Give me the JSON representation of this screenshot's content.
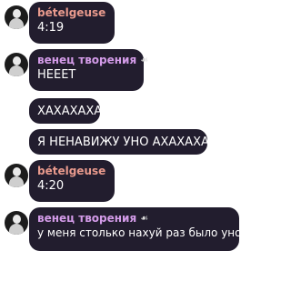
{
  "messages": [
    {
      "author": "bételgeuse",
      "badge_icon": "image-badge-icon",
      "text": "4:19"
    },
    {
      "author": "венец творения",
      "badge_icon": "emoji-badge-icon",
      "badge_glyph": "☙",
      "text": "НЕЕЕТ"
    },
    {
      "text": "ХАХАХАХА"
    },
    {
      "text": "Я НЕНАВИЖУ УНО АХАХАХАХА"
    },
    {
      "author": "bételgeuse",
      "badge_icon": "image-badge-icon",
      "text": "4:20"
    },
    {
      "author": "венец творения",
      "badge_icon": "emoji-badge-icon",
      "badge_glyph": "☙",
      "text": "у меня столько нахуй раз было уно."
    }
  ],
  "colors": {
    "bubble_bg": "#221d2e",
    "author_1": "#e99a8d",
    "author_2": "#d39be8",
    "text": "#ffffff",
    "page_bg": "#ffffff"
  }
}
